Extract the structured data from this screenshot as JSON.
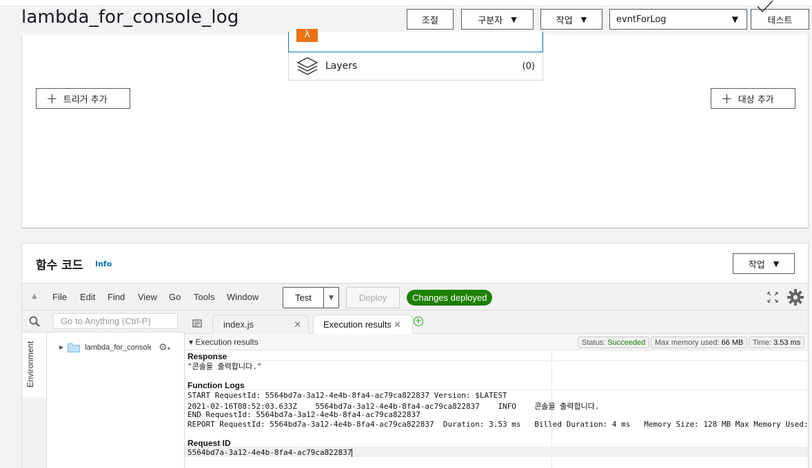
{
  "header": {
    "title": "lambda_for_console_log",
    "throttle_label": "조절",
    "qualifiers_label": "구분자",
    "actions_label": "작업",
    "test_event_value": "evntForLog",
    "test_label": "테스트"
  },
  "designer": {
    "layers_label": "Layers",
    "layers_count": "(0)",
    "add_trigger_label": "트리거 추가",
    "add_destination_label": "대상 추가"
  },
  "code": {
    "title": "함수 코드",
    "info_label": "Info",
    "actions_label": "작업",
    "menu": [
      "File",
      "Edit",
      "Find",
      "View",
      "Go",
      "Tools",
      "Window"
    ],
    "test_label": "Test",
    "deploy_label": "Deploy",
    "deployed_badge": "Changes deployed",
    "search_placeholder": "Go to Anything (Ctrl-P)",
    "environment_label": "Environment",
    "tree_folder": "lambda_for_console_log",
    "tabs": [
      {
        "label": "index.js"
      },
      {
        "label": "Execution results"
      }
    ]
  },
  "results": {
    "title": "Execution results",
    "status_label": "Status:",
    "status_value": "Succeeded",
    "memory_label": "Max memory used:",
    "memory_value": "66 MB",
    "time_label": "Time:",
    "time_value": "3.53 ms",
    "response_heading": "Response",
    "response_value": "\"콘솔을 출력합니다.\"",
    "logs_heading": "Function Logs",
    "log_lines": [
      "START RequestId: 5564bd7a-3a12-4e4b-8fa4-ac79ca822837 Version: $LATEST",
      "2021-02-16T08:52:03.633Z    5564bd7a-3a12-4e4b-8fa4-ac79ca822837    INFO    콘솔을 출력합니다.",
      "END RequestId: 5564bd7a-3a12-4e4b-8fa4-ac79ca822837",
      "REPORT RequestId: 5564bd7a-3a12-4e4b-8fa4-ac79ca822837  Duration: 3.53 ms   Billed Duration: 4 ms   Memory Size: 128 MB Max Memory Used:"
    ],
    "request_heading": "Request ID",
    "request_id": "5564bd7a-3a12-4e4b-8fa4-ac79ca822837"
  },
  "colors": {
    "accent_orange": "#ec7211",
    "deployed_green": "#1d8102",
    "link_blue": "#0073bb"
  },
  "icons": [
    "lambda-icon",
    "layers-icon",
    "plus-icon",
    "fullscreen-icon",
    "gear-icon",
    "search-icon",
    "folder-icon",
    "tab-menu-icon",
    "add-tab-icon",
    "close-icon",
    "checkmark-icon"
  ]
}
